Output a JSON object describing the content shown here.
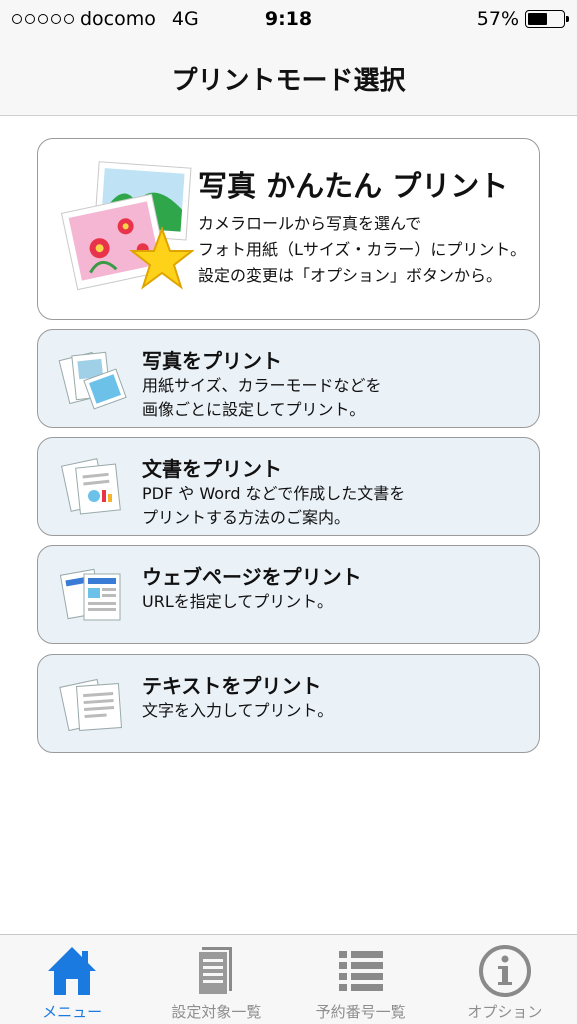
{
  "status_bar": {
    "carrier": "docomo",
    "network": "4G",
    "time": "9:18",
    "battery_text": "57%",
    "battery_level_percent": 57
  },
  "nav": {
    "title": "プリントモード選択"
  },
  "hero": {
    "title": "写真 かんたん プリント",
    "desc_line1": "カメラロールから写真を選んで",
    "desc_line2": "フォト用紙（Lサイズ・カラー）にプリント。",
    "desc_line3": "設定の変更は「オプション」ボタンから。"
  },
  "items": [
    {
      "title": "写真をプリント",
      "line1": "用紙サイズ、カラーモードなどを",
      "line2": "画像ごとに設定してプリント。",
      "icon": "photo-print-icon"
    },
    {
      "title": "文書をプリント",
      "line1": "PDF や Word などで作成した文書を",
      "line2": "プリントする方法のご案内。",
      "icon": "document-print-icon"
    },
    {
      "title": "ウェブページをプリント",
      "line1": "URLを指定してプリント。",
      "line2": "",
      "icon": "webpage-print-icon"
    },
    {
      "title": "テキストをプリント",
      "line1": "文字を入力してプリント。",
      "line2": "",
      "icon": "text-print-icon"
    }
  ],
  "tabs": [
    {
      "label": "メニュー",
      "icon": "home-icon",
      "active": true
    },
    {
      "label": "設定対象一覧",
      "icon": "document-icon",
      "active": false
    },
    {
      "label": "予約番号一覧",
      "icon": "list-icon",
      "active": false
    },
    {
      "label": "オプション",
      "icon": "info-icon",
      "active": false
    }
  ],
  "colors": {
    "accent": "#1a7ae0",
    "card_background": "#eaf1f7",
    "inactive_tab": "#8e8e8e"
  }
}
